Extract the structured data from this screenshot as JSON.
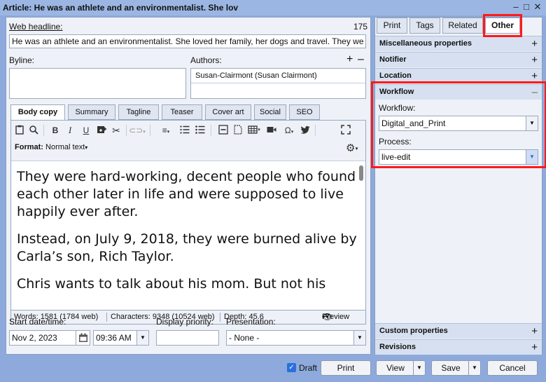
{
  "window": {
    "title": "Article: He was an athlete and an environmentalist. She lov",
    "minimize_glyph": "–",
    "maximize_glyph": "□",
    "close_glyph": "✕"
  },
  "article": {
    "web_headline_label": "Web headline:",
    "web_headline_count": "175",
    "web_headline_value": "He was an athlete and an environmentalist. She loved her family, her dogs and travel. They we",
    "byline_label": "Byline:",
    "authors_label": "Authors:",
    "authors_add": "+",
    "authors_remove": "–",
    "author_entry": "Susan-Clairmont (Susan Clairmont)"
  },
  "tabs": [
    "Body copy",
    "Summary",
    "Tagline",
    "Teaser",
    "Cover art",
    "Social",
    "SEO"
  ],
  "toolbar": {
    "format_label": "Format:",
    "format_value": "Normal text",
    "format_caret": "▾",
    "special_char": "Ω",
    "bold": "B",
    "italic": "I",
    "underline": "U"
  },
  "body_text": [
    "They were hard-working, decent people who found each other later in life and were supposed to live happily ever after.",
    "Instead, on July 9, 2018, they were burned alive by Carla’s son, Rich Taylor.",
    "Chris wants to talk about his mom. But not his"
  ],
  "status": {
    "words": "Words: 1581 (1784 web)",
    "characters": "Characters: 9348 (10524 web)",
    "depth": "Depth: 45.6",
    "preview": "Preview"
  },
  "scheduling": {
    "start_label": "Start date/time:",
    "start_date": "Nov 2, 2023",
    "start_time": "09:36 AM",
    "priority_label": "Display priority:",
    "priority_value": "",
    "presentation_label": "Presentation:",
    "presentation_value": "- None -"
  },
  "right_tabs": [
    "Print",
    "Tags",
    "Related",
    "Other"
  ],
  "sections": {
    "misc": "Miscellaneous properties",
    "notifier": "Notifier",
    "location": "Location",
    "workflow": "Workflow",
    "custom": "Custom properties",
    "revisions": "Revisions",
    "expand_glyph": "+",
    "collapse_glyph": "–"
  },
  "workflow": {
    "workflow_label": "Workflow:",
    "workflow_value": "Digital_and_Print",
    "process_label": "Process:",
    "process_value": "live-edit"
  },
  "footer": {
    "draft_label": "Draft",
    "print": "Print",
    "view": "View",
    "save": "Save",
    "cancel": "Cancel"
  },
  "colors": {
    "accent": "#2a6fdb",
    "highlight": "#ff1a1a",
    "panel_bg": "#eef1f7",
    "header_bg": "#d6e0f0"
  }
}
